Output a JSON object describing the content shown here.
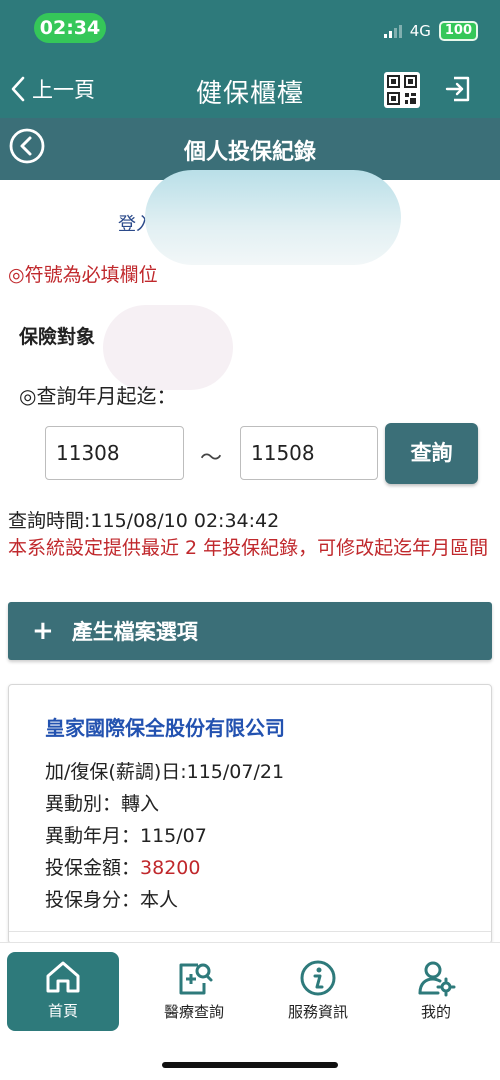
{
  "status_bar": {
    "time": "02:34",
    "network": "4G",
    "battery": "100"
  },
  "nav": {
    "back_label": "上一頁",
    "title": "健保櫃檯"
  },
  "section": {
    "title": "個人投保紀錄"
  },
  "form": {
    "login_prefix": "登入",
    "required_note": "◎符號為必填欄位",
    "insured_label": "保險對象",
    "query_range_label": "◎查詢年月起迄：",
    "start_value": "11308",
    "separator": "～",
    "end_value": "11508",
    "query_button": "查詢"
  },
  "info": {
    "query_time": "查詢時間:115/08/10 02:34:42",
    "system_note": "本系統設定提供最近 2 年投保紀錄，可修改起迄年月區間"
  },
  "generate": {
    "icon": "+",
    "label": "產生檔案選項"
  },
  "record": {
    "company": "皇家國際保全股份有限公司",
    "join_date": "加/復保(薪調)日:115/07/21",
    "change_type": "異動別：轉入",
    "change_month": "異動年月：115/07",
    "amount_label": "投保金額：",
    "amount_value": "38200",
    "identity": "投保身分：本人"
  },
  "tabs": [
    {
      "label": "首頁",
      "icon": "home-icon",
      "active": true
    },
    {
      "label": "醫療查詢",
      "icon": "medical-search-icon",
      "active": false
    },
    {
      "label": "服務資訊",
      "icon": "info-icon",
      "active": false
    },
    {
      "label": "我的",
      "icon": "user-settings-icon",
      "active": false
    }
  ],
  "colors": {
    "primary": "#2e7a7b",
    "header": "#3b6f78",
    "alert": "#c0282c",
    "link": "#2352b0"
  }
}
